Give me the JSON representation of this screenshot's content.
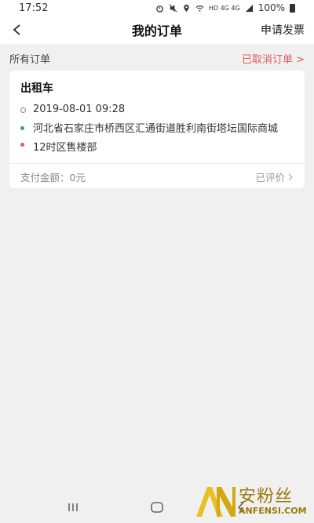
{
  "status_bar": {
    "time": "17:52",
    "network_label": "HD 4G 4G",
    "battery_text": "100%"
  },
  "header": {
    "title": "我的订单",
    "right_action": "申请发票"
  },
  "section": {
    "title": "所有订单",
    "status_link": "已取消订单 >"
  },
  "order": {
    "type": "出租车",
    "datetime": "2019-08-01 09:28",
    "origin": "河北省石家庄市桥西区汇通街道胜利南街塔坛国际商城",
    "destination": "12时区售楼部",
    "payment": "支付金额：0元",
    "review_status": "已评价"
  },
  "watermark": {
    "cn": "安粉丝",
    "en": "ANFENSI.COM"
  },
  "colors": {
    "accent_red": "#e05a5a",
    "origin_green": "#2ea36b",
    "watermark_gold": "#9a7a10"
  }
}
